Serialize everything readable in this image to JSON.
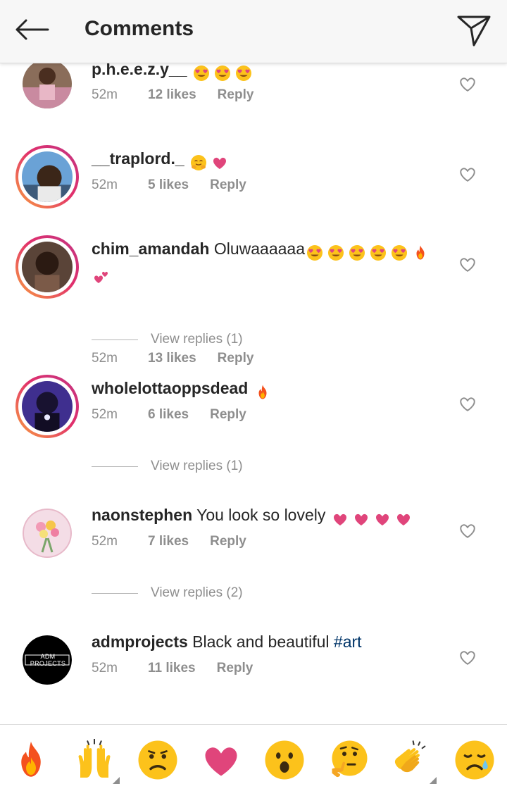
{
  "header": {
    "title": "Comments"
  },
  "comments": [
    {
      "username": "p.h.e.e.z.y__",
      "text": "",
      "time": "52m",
      "likes": "12 likes",
      "reply": "Reply"
    },
    {
      "username": "__traplord._",
      "text": "",
      "time": "52m",
      "likes": "5 likes",
      "reply": "Reply"
    },
    {
      "username": "chim_amandah",
      "text": "Oluwaaaaaa",
      "time": "52m",
      "likes": "13 likes",
      "reply": "Reply",
      "view_replies": "View replies (1)"
    },
    {
      "username": "wholelottaoppsdead",
      "text": "",
      "time": "52m",
      "likes": "6 likes",
      "reply": "Reply",
      "view_replies": "View replies (1)"
    },
    {
      "username": "naonstephen",
      "text": "You look so lovely",
      "time": "52m",
      "likes": "7 likes",
      "reply": "Reply",
      "view_replies": "View replies (2)"
    },
    {
      "username": "admprojects",
      "text": "Black and beautiful",
      "hashtag": "#art",
      "time": "52m",
      "likes": "11 likes",
      "reply": "Reply",
      "avatar_text": "ADM PROJECTS"
    }
  ],
  "emoji_bar": [
    "fire-emoji",
    "raised-hands-emoji",
    "confused-face-emoji",
    "heart-emoji",
    "surprised-face-emoji",
    "thinking-face-emoji",
    "clapping-hands-emoji",
    "sad-face-emoji"
  ],
  "colors": {
    "ring_start": "#f9a03f",
    "ring_end": "#c13584",
    "heart_pink": "#e0457b",
    "hashtag": "#003569",
    "meta_grey": "#8e8e8e"
  }
}
